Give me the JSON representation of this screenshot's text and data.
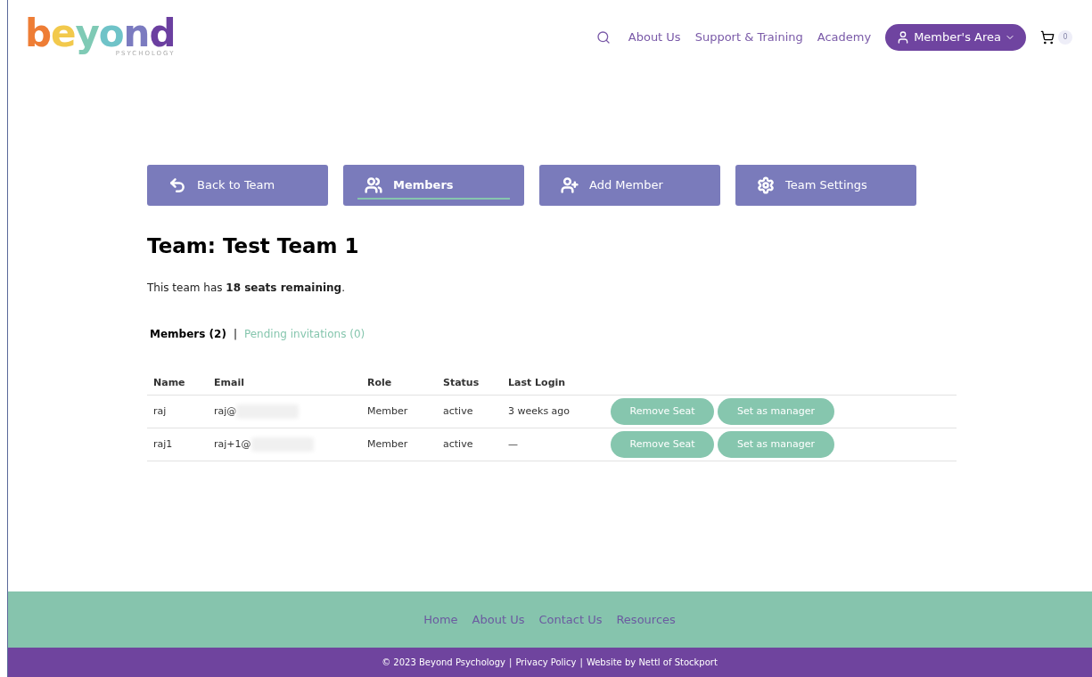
{
  "logo": {
    "word": "beyond",
    "tagline": "PSYCHOLOGY"
  },
  "nav": {
    "links": [
      "About Us",
      "Support & Training",
      "Academy"
    ],
    "member_button": "Member's Area",
    "cart_count": "0"
  },
  "actions": [
    {
      "kind": "back",
      "label": "Back to Team",
      "selected": false
    },
    {
      "kind": "members",
      "label": "Members",
      "selected": true
    },
    {
      "kind": "add",
      "label": "Add Member",
      "selected": false
    },
    {
      "kind": "settings",
      "label": "Team Settings",
      "selected": false
    }
  ],
  "title": "Team: Test Team 1",
  "seats_text": "This team has **18 seats remaining**.",
  "subtabs": [
    {
      "label": "Members (2)",
      "selected": true
    },
    {
      "label": "Pending invitations (0)",
      "selected": false
    }
  ],
  "subtab_separator": "|",
  "table": {
    "columns": [
      "Name",
      "Email",
      "Role",
      "Status",
      "Last Login"
    ],
    "rows": [
      {
        "cells": [
          "raj",
          "raj@",
          "Member",
          "active",
          "3 weeks ago"
        ],
        "buttons": [
          "Remove Seat",
          "Set as manager"
        ]
      },
      {
        "cells": [
          "raj1",
          "raj+1@",
          "Member",
          "active",
          "—"
        ],
        "buttons": [
          "Remove Seat",
          "Set as manager"
        ]
      }
    ]
  },
  "footer": {
    "links": [
      "Home",
      "About Us",
      "Contact Us",
      "Resources"
    ],
    "bottom": [
      "© 2023 Beyond Psychology",
      "Privacy Policy",
      "Website by Nettl of Stockport"
    ],
    "separator": "|"
  }
}
